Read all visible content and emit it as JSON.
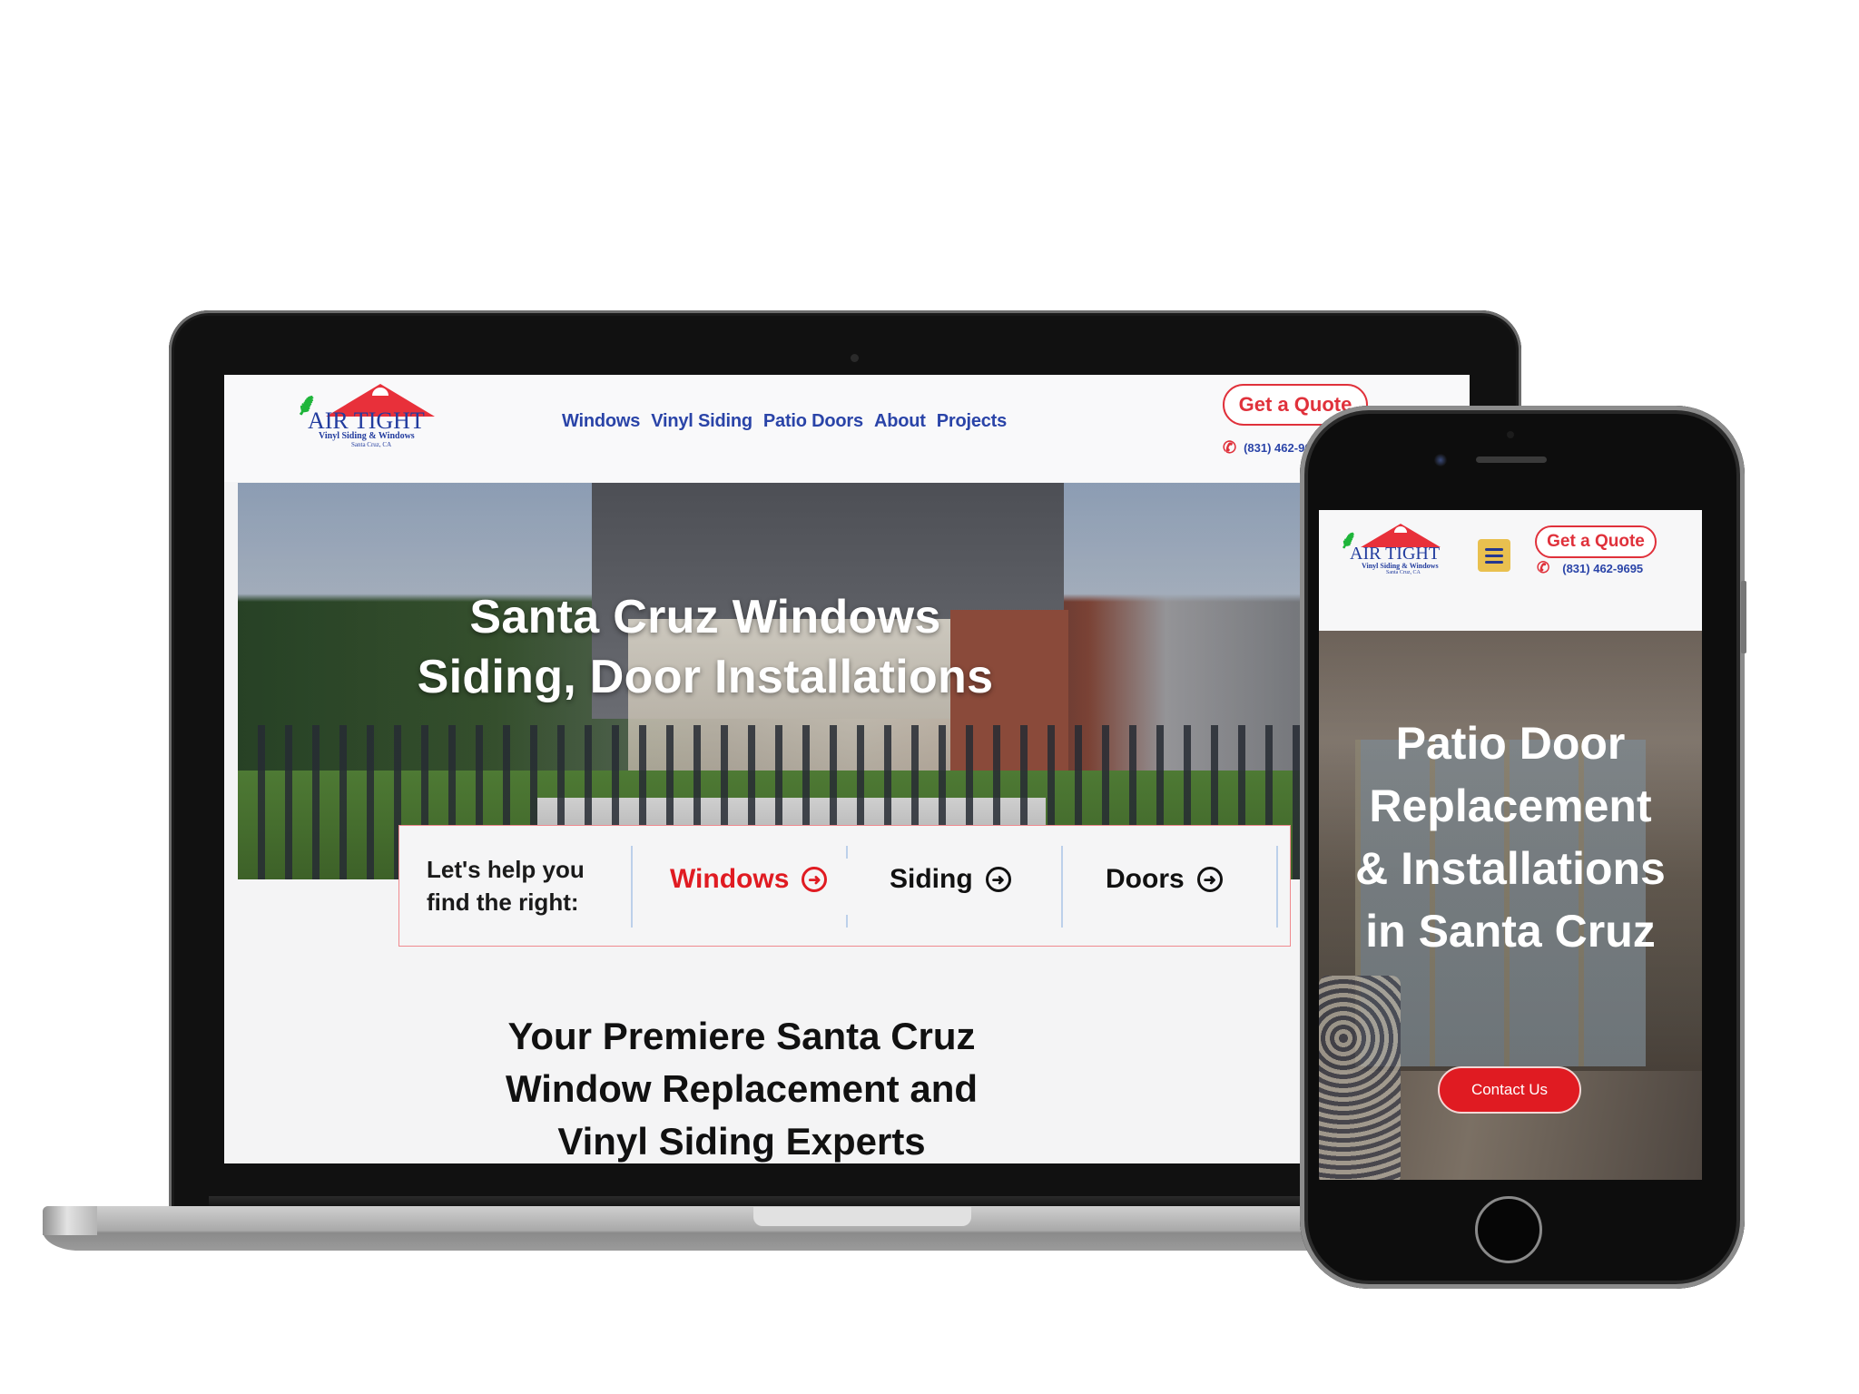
{
  "brand": {
    "name": "AIR TIGHT",
    "tagline": "Vinyl Siding & Windows",
    "location": "Santa Cruz, CA",
    "colors": {
      "primary_blue": "#2a44a8",
      "accent_red": "#e0313b",
      "menu_yellow": "#e9c04f"
    }
  },
  "desktop": {
    "nav": {
      "items": [
        {
          "label": "Windows"
        },
        {
          "label": "Vinyl Siding"
        },
        {
          "label": "Patio Doors"
        },
        {
          "label": "About"
        },
        {
          "label": "Projects"
        }
      ]
    },
    "header": {
      "quote_label": "Get a Quote",
      "phone_icon": "phone-icon",
      "phone": "(831) 462-9695"
    },
    "hero": {
      "title_line1": "Santa Cruz Windows",
      "title_line2": "Siding, Door Installations"
    },
    "finder": {
      "label_line1": "Let's help you",
      "label_line2": "find the right:",
      "items": [
        {
          "label": "Windows",
          "icon": "arrow-right-circle-icon",
          "active": true
        },
        {
          "label": "Siding",
          "icon": "arrow-right-circle-icon",
          "active": false
        },
        {
          "label": "Doors",
          "icon": "arrow-right-circle-icon",
          "active": false
        }
      ]
    },
    "about": {
      "line1": "Your Premiere Santa Cruz",
      "line2": "Window Replacement and",
      "line3": "Vinyl Siding Experts"
    }
  },
  "mobile": {
    "header": {
      "menu_icon": "hamburger-icon",
      "quote_label": "Get a Quote",
      "phone": "(831) 462-9695"
    },
    "hero": {
      "line1": "Patio Door",
      "line2": "Replacement",
      "line3": "& Installations",
      "line4": "in Santa Cruz",
      "cta_label": "Contact Us"
    }
  },
  "icons": {
    "arrow": "➜",
    "phone": "✆"
  }
}
